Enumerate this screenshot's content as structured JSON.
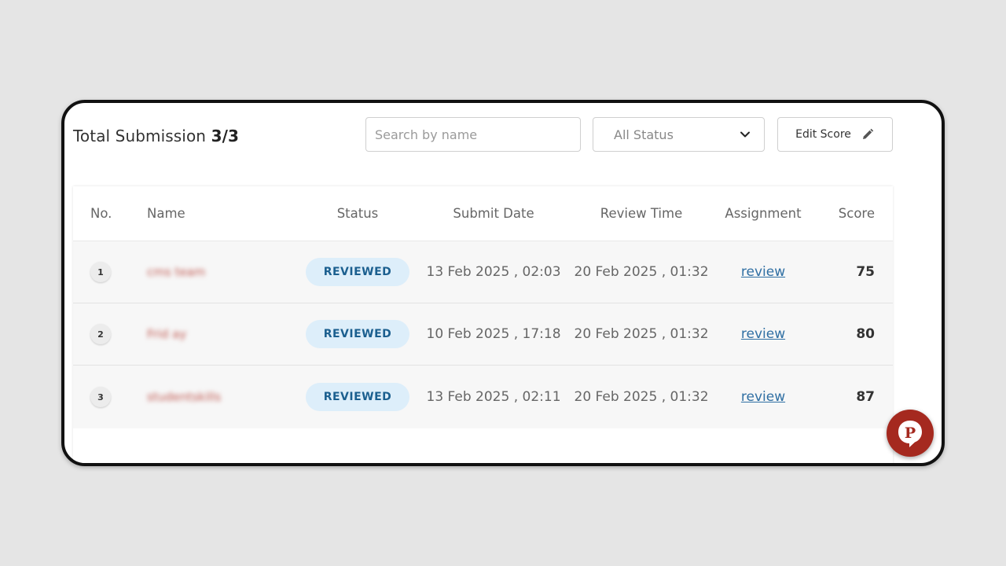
{
  "header": {
    "total_label": "Total Submission",
    "total_count": "3/3",
    "search_placeholder": "Search by name",
    "status_filter": "All Status",
    "edit_score_label": "Edit Score"
  },
  "table": {
    "columns": {
      "no": "No.",
      "name": "Name",
      "status": "Status",
      "submit_date": "Submit Date",
      "review_time": "Review Time",
      "assignment": "Assignment",
      "score": "Score"
    },
    "rows": [
      {
        "no": "1",
        "name": "cms team",
        "status": "REVIEWED",
        "submit_date": "13 Feb 2025 , 02:03",
        "review_time": "20 Feb 2025 , 01:32",
        "assignment": "review",
        "score": "75"
      },
      {
        "no": "2",
        "name": "Frid ay",
        "status": "REVIEWED",
        "submit_date": "10 Feb 2025 , 17:18",
        "review_time": "20 Feb 2025 , 01:32",
        "assignment": "review",
        "score": "80"
      },
      {
        "no": "3",
        "name": "studentskills",
        "status": "REVIEWED",
        "submit_date": "13 Feb 2025 , 02:11",
        "review_time": "20 Feb 2025 , 01:32",
        "assignment": "review",
        "score": "87"
      }
    ]
  },
  "fab": {
    "letter": "P"
  },
  "colors": {
    "status_pill_bg": "#ddeefa",
    "status_pill_text": "#1b5f8f",
    "link": "#2f6fa3",
    "fab": "#a5291f"
  },
  "icons": {
    "dropdown": "chevron-down-icon",
    "edit": "pencil-icon",
    "fab": "p-logo-icon"
  }
}
